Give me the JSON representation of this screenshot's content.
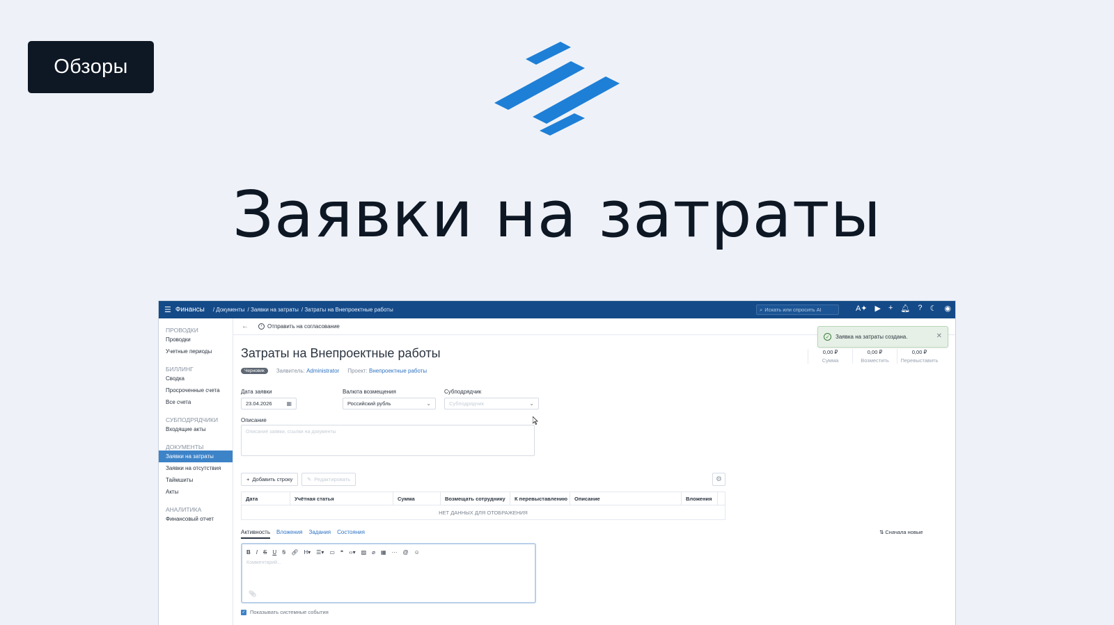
{
  "overlay": {
    "badge": "Обзоры",
    "title": "Заявки на затраты",
    "brand_color": "#1e7fd6"
  },
  "app": {
    "name": "Финансы",
    "breadcrumb": [
      "/ Документы",
      "/ Заявки на затраты",
      "/ Затраты на Внепроектные работы"
    ],
    "search_placeholder": "Искать или спросить AI",
    "topbar_color": "#144a88"
  },
  "sidebar": {
    "groups": [
      {
        "title": "ПРОВОДКИ",
        "items": [
          "Проводки",
          "Учетные периоды"
        ]
      },
      {
        "title": "БИЛЛИНГ",
        "items": [
          "Сводка",
          "Просроченные счета",
          "Все счета"
        ]
      },
      {
        "title": "СУБПОДРЯДЧИКИ",
        "items": [
          "Входящие акты"
        ]
      },
      {
        "title": "ДОКУМЕНТЫ",
        "items": [
          "Заявки на затраты",
          "Заявки на отсутствия",
          "Таймшиты",
          "Акты"
        ]
      },
      {
        "title": "АНАЛИТИКА",
        "items": [
          "Финансовый отчет"
        ]
      }
    ],
    "active_item": "Заявки на затраты"
  },
  "toolbar": {
    "back_icon": "arrow-left-icon",
    "send_label": "Отправить на согласование"
  },
  "document": {
    "title": "Затраты на Внепроектные работы",
    "status": "Черновик",
    "applicant_label": "Заявитель:",
    "applicant": "Administrator",
    "project_label": "Проект:",
    "project": "Внепроектные работы"
  },
  "totals": [
    {
      "value": "0,00 ₽",
      "label": "Сумма"
    },
    {
      "value": "0,00 ₽",
      "label": "Возместить"
    },
    {
      "value": "0,00 ₽",
      "label": "Перевыставить"
    }
  ],
  "toast": {
    "text": "Заявка на затраты создана."
  },
  "form": {
    "date_label": "Дата заявки",
    "date_value": "23.04.2026",
    "currency_label": "Валюта возмещения",
    "currency_value": "Российский рубль",
    "subcontractor_label": "Субподрядчик",
    "subcontractor_placeholder": "Субподрядчик",
    "description_label": "Описание",
    "description_placeholder": "Описание заявки, ссылки на документы"
  },
  "lines": {
    "add_label": "Добавить строку",
    "edit_label": "Редактировать",
    "columns": [
      "Дата",
      "Учётная статья",
      "Сумма",
      "Возмещать сотруднику",
      "К перевыставлению",
      "Описание",
      "Вложения"
    ],
    "empty_text": "НЕТ ДАННЫХ ДЛЯ ОТОБРАЖЕНИЯ"
  },
  "activity": {
    "tabs": [
      "Активность",
      "Вложения",
      "Задания",
      "Состояния"
    ],
    "sort_label": "Сначала новые",
    "editor_placeholder": "Комментарий...",
    "show_system_label": "Показывать системные события"
  }
}
